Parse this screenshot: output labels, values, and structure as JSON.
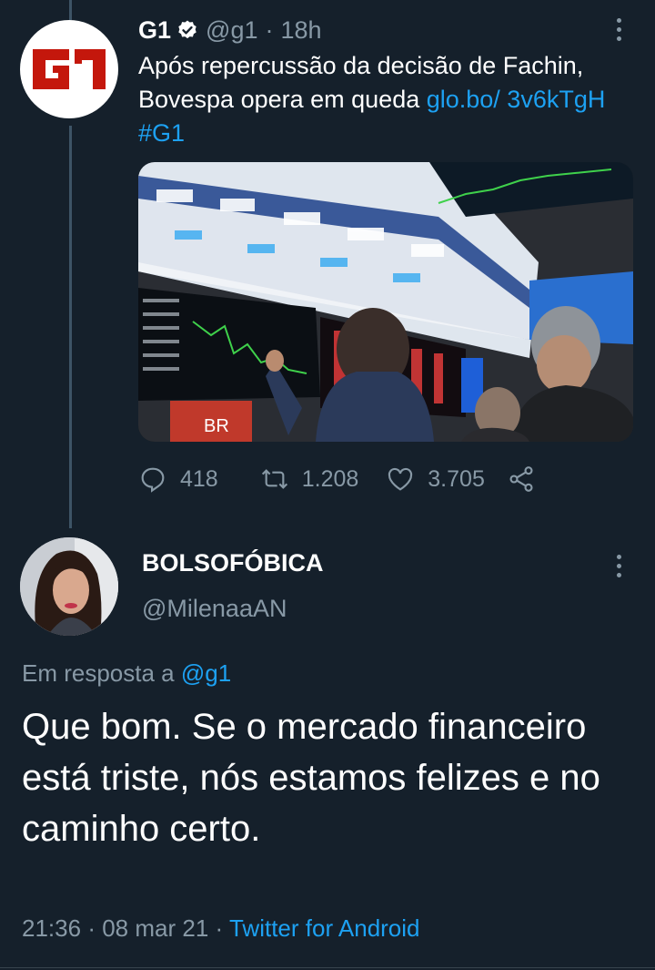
{
  "original_tweet": {
    "display_name": "G1",
    "handle": "@g1",
    "separator": "·",
    "time_ago": "18h",
    "text_plain": "Após repercussão da decisão de Fachin, Bovespa opera em queda ",
    "link_text": "glo.bo/ 3v6kTgH",
    "hashtag": "#G1",
    "avatar_logo": "G1",
    "image_sign_text": "BR",
    "replies": "418",
    "retweets": "1.208",
    "likes": "3.705"
  },
  "reply": {
    "display_name": "BOLSOFÓBICA",
    "handle": "@MilenaaAN",
    "replying_to_label": "Em resposta a",
    "replying_to_handle": "@g1",
    "text": "Que bom. Se o mercado financeiro está triste, nós estamos felizes e no caminho certo.",
    "time": "21:36",
    "separator": "·",
    "date": "08 mar 21",
    "source": "Twitter for Android"
  },
  "colors": {
    "background": "#15202b",
    "accent": "#1da1f2",
    "secondary_text": "#8899a6",
    "g1_red": "#c4170c"
  },
  "icons": [
    "verified-badge-icon",
    "more-vertical-icon",
    "reply-icon",
    "retweet-icon",
    "like-icon",
    "share-icon"
  ]
}
